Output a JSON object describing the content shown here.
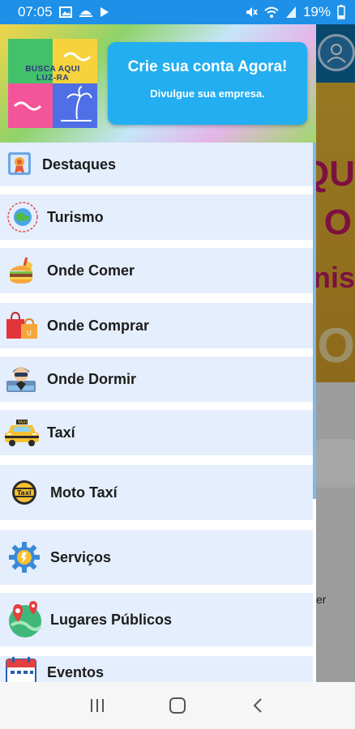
{
  "status_bar": {
    "time": "07:05",
    "battery": "19%"
  },
  "background_app": {
    "big_letters_1": "QU",
    "big_letters_2": "O",
    "big_letters_3": "nis",
    "big_letters_4": "O",
    "partial_text": "er"
  },
  "drawer": {
    "logo_text_line1": "BUSCA AQUI",
    "logo_text_line2": "LUZ-RA",
    "cta_title": "Crie sua conta Agora!",
    "cta_subtitle": "Divulgue sua empresa.",
    "menu": [
      {
        "label": "Destaques",
        "icon": "award-icon"
      },
      {
        "label": "Turismo",
        "icon": "globe-icon"
      },
      {
        "label": "Onde Comer",
        "icon": "food-icon"
      },
      {
        "label": "Onde Comprar",
        "icon": "shopping-bags-icon"
      },
      {
        "label": "Onde Dormir",
        "icon": "sleep-icon"
      },
      {
        "label": "Taxí",
        "icon": "taxi-icon"
      },
      {
        "label": "Moto Taxí",
        "icon": "moto-taxi-icon"
      },
      {
        "label": "Serviços",
        "icon": "gear-icon"
      },
      {
        "label": "Lugares Públicos",
        "icon": "map-pin-icon"
      },
      {
        "label": "Eventos",
        "icon": "calendar-icon"
      }
    ]
  },
  "colors": {
    "status_bar": "#1e90e8",
    "cta": "#22aef0",
    "menu_item_bg": "#e5eefc"
  }
}
